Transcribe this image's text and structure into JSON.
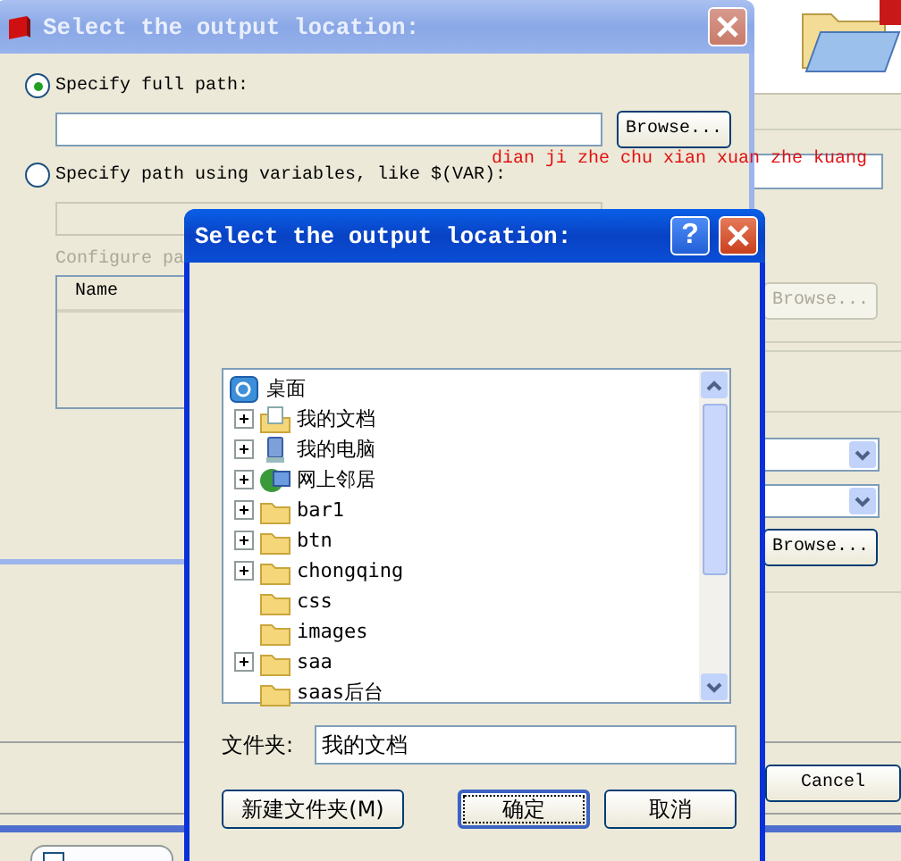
{
  "background_app": {
    "browse_buttons": [
      {
        "label": "Browse...",
        "disabled": true
      },
      {
        "label": "Browse...",
        "disabled": false
      }
    ],
    "cancel_button": "Cancel"
  },
  "back_dialog": {
    "title": "Select the output location:",
    "active": false,
    "options": [
      {
        "label": "Specify full path:",
        "selected": true
      },
      {
        "label": "Specify path using variables, like $(VAR):",
        "selected": false
      }
    ],
    "browse_button": "Browse...",
    "configure_label": "Configure pa",
    "list_columns": [
      "Name"
    ]
  },
  "annotation": "dian ji zhe  chu xian xuan zhe kuang",
  "front_dialog": {
    "title": "Select the output location:",
    "active": true,
    "help_button": "?",
    "tree": {
      "label": "桌面",
      "kind": "desktop",
      "children": [
        {
          "label": "我的文档",
          "kind": "documents",
          "expandable": true
        },
        {
          "label": "我的电脑",
          "kind": "computer",
          "expandable": true
        },
        {
          "label": "网上邻居",
          "kind": "network",
          "expandable": true
        },
        {
          "label": "bar1",
          "kind": "folder",
          "expandable": true
        },
        {
          "label": "btn",
          "kind": "folder",
          "expandable": true
        },
        {
          "label": "chongqing",
          "kind": "folder",
          "expandable": true
        },
        {
          "label": "css",
          "kind": "folder",
          "expandable": false
        },
        {
          "label": "images",
          "kind": "folder",
          "expandable": false
        },
        {
          "label": "saa",
          "kind": "folder",
          "expandable": true
        },
        {
          "label": "saas后台",
          "kind": "folder",
          "expandable": false
        }
      ]
    },
    "folder_label": "文件夹:",
    "folder_value": "我的文档",
    "buttons": [
      {
        "label": "新建文件夹(M)",
        "default": false
      },
      {
        "label": "确定",
        "default": true
      },
      {
        "label": "取消",
        "default": false
      }
    ]
  }
}
